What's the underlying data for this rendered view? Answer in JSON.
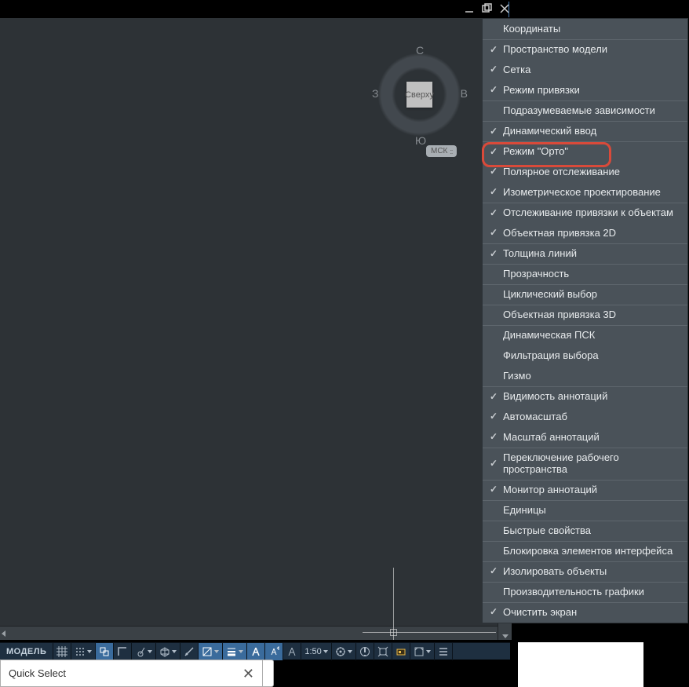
{
  "window_controls": [
    "minimize",
    "maximize",
    "close"
  ],
  "compass": {
    "center_label": "Сверху",
    "labels": {
      "n": "С",
      "s": "Ю",
      "w": "З",
      "e": "В"
    }
  },
  "ucs_badge": "МСК",
  "context_menu": [
    {
      "label": "Координаты",
      "checked": false,
      "sep": false
    },
    {
      "label": "Пространство модели",
      "checked": true,
      "sep": true
    },
    {
      "label": "Сетка",
      "checked": true,
      "sep": false
    },
    {
      "label": "Режим привязки",
      "checked": true,
      "sep": false
    },
    {
      "label": "Подразумеваемые зависимости",
      "checked": false,
      "sep": true
    },
    {
      "label": "Динамический ввод",
      "checked": true,
      "sep": true,
      "highlighted": true
    },
    {
      "label": "Режим \"Орто\"",
      "checked": true,
      "sep": true
    },
    {
      "label": "Полярное отслеживание",
      "checked": true,
      "sep": false
    },
    {
      "label": "Изометрическое проектирование",
      "checked": true,
      "sep": false
    },
    {
      "label": "Отслеживание привязки к объектам",
      "checked": true,
      "sep": true
    },
    {
      "label": "Объектная привязка 2D",
      "checked": true,
      "sep": false
    },
    {
      "label": "Толщина линий",
      "checked": true,
      "sep": true
    },
    {
      "label": "Прозрачность",
      "checked": false,
      "sep": true
    },
    {
      "label": "Циклический выбор",
      "checked": false,
      "sep": true
    },
    {
      "label": "Объектная привязка 3D",
      "checked": false,
      "sep": true
    },
    {
      "label": "Динамическая ПСК",
      "checked": false,
      "sep": true
    },
    {
      "label": "Фильтрация выбора",
      "checked": false,
      "sep": false
    },
    {
      "label": "Гизмо",
      "checked": false,
      "sep": false
    },
    {
      "label": "Видимость аннотаций",
      "checked": true,
      "sep": true
    },
    {
      "label": "Автомасштаб",
      "checked": true,
      "sep": false
    },
    {
      "label": "Масштаб аннотаций",
      "checked": true,
      "sep": false
    },
    {
      "label": "Переключение рабочего пространства",
      "checked": true,
      "sep": true
    },
    {
      "label": "Монитор аннотаций",
      "checked": true,
      "sep": true
    },
    {
      "label": "Единицы",
      "checked": false,
      "sep": true
    },
    {
      "label": "Быстрые свойства",
      "checked": false,
      "sep": true
    },
    {
      "label": "Блокировка элементов интерфейса",
      "checked": false,
      "sep": true
    },
    {
      "label": "Изолировать объекты",
      "checked": true,
      "sep": true
    },
    {
      "label": "Производительность графики",
      "checked": false,
      "sep": true
    },
    {
      "label": "Очистить экран",
      "checked": true,
      "sep": true
    }
  ],
  "status_bar": {
    "model": "МОДЕЛЬ",
    "scale": "1:50"
  },
  "quick_select_title": "Quick Select"
}
